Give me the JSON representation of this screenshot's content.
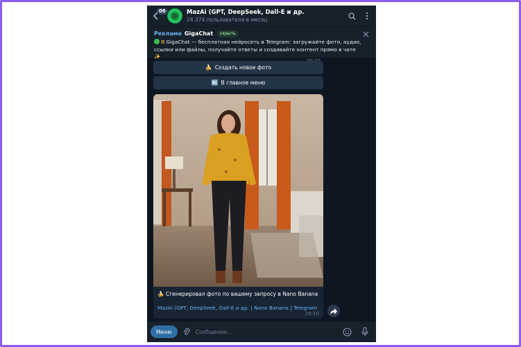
{
  "header": {
    "unread_count": "06",
    "title": "MazAi (GPT, DeepSeek, Dall-E и др.",
    "subtitle": "24 374 пользователя в месяц"
  },
  "ad": {
    "label": "Реклама",
    "sponsor": "GigaChat",
    "hide_label": "скрыть",
    "text": "GigaChat — бесплатная нейросеть в Telegram: загружайте фото, аудио, ссылки или файлы, получайте ответы и создавайте контент прямо в чате"
  },
  "messages": {
    "time_top": "20:10",
    "buttons": [
      {
        "emoji": "🍌",
        "label": "Создать новое фото"
      },
      {
        "emoji": "⬅️",
        "label": "В главное меню"
      }
    ],
    "photo_caption_emoji": "🍌",
    "photo_caption": "Сгенерировал фото по вашему запросу в Nano Banana",
    "caption_link": "MazAi (GPT, DeepSeek, Dall-E и др. | Nano Banana | Telegram",
    "time_bottom": "20:10"
  },
  "composer": {
    "menu_label": "Меню",
    "placeholder": "Сообщение..."
  },
  "colors": {
    "frame": "#8b5cf6",
    "chat_bg": "#0e1621",
    "header_bg": "#17212b",
    "accent": "#6ab2f2",
    "menu_button": "#2f6ea5"
  },
  "icons": [
    "back-arrow-icon",
    "search-icon",
    "more-vertical-icon",
    "close-icon",
    "forward-icon",
    "paperclip-icon",
    "emoji-icon",
    "microphone-icon"
  ]
}
